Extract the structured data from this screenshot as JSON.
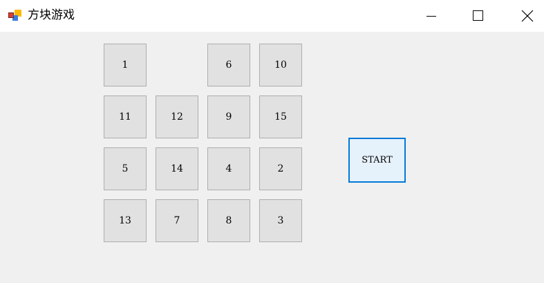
{
  "window": {
    "title": "方块游戏",
    "icon": "winforms-app-icon",
    "controls": {
      "minimize_icon": "minimize-icon",
      "maximize_icon": "maximize-icon",
      "close_icon": "close-icon"
    }
  },
  "board": {
    "rows": [
      [
        "1",
        "",
        "6",
        "10"
      ],
      [
        "11",
        "12",
        "9",
        "15"
      ],
      [
        "5",
        "14",
        "4",
        "2"
      ],
      [
        "13",
        "7",
        "8",
        "3"
      ]
    ]
  },
  "start_button": {
    "label": "START"
  },
  "colors": {
    "client_bg": "#f0f0f0",
    "tile_bg": "#e1e1e1",
    "tile_border": "#adadad",
    "start_border": "#0078d7",
    "start_bg": "#e5f1fb"
  }
}
